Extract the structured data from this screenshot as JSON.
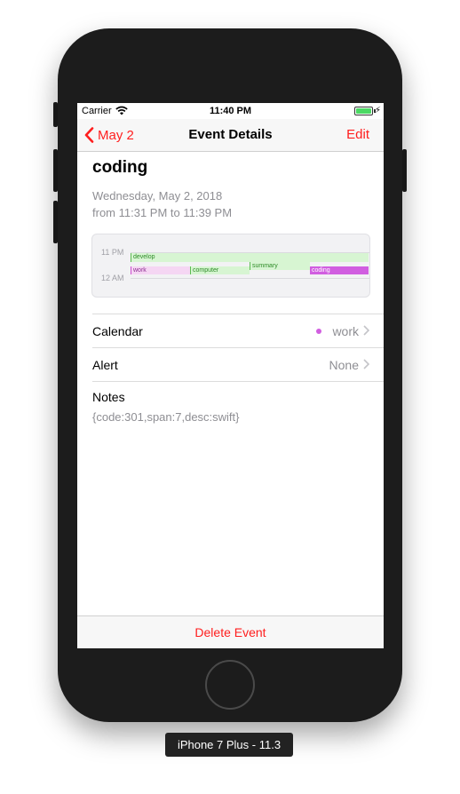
{
  "status_bar": {
    "carrier": "Carrier",
    "time": "11:40 PM",
    "battery_color": "#4cd964",
    "icons": [
      "wifi-icon",
      "battery-icon",
      "charging-bolt-icon"
    ]
  },
  "nav": {
    "back_label": "May 2",
    "title": "Event Details",
    "edit_label": "Edit",
    "accent_color": "#ff1e1e"
  },
  "event": {
    "title": "coding",
    "date": "Wednesday, May 2, 2018",
    "time_range": "from 11:31 PM to 11:39 PM"
  },
  "timeline": {
    "hours": [
      "11 PM",
      "12 AM"
    ],
    "events": [
      {
        "label": "develop",
        "color": "#d7f5d2"
      },
      {
        "label": "summary",
        "color": "#d7f5d2"
      },
      {
        "label": "work",
        "color": "#f5d6f3"
      },
      {
        "label": "computer",
        "color": "#d7f5d2"
      },
      {
        "label": "coding",
        "color": "#d15ee0"
      }
    ]
  },
  "calendar_row": {
    "label": "Calendar",
    "value": "work",
    "dot_color": "#d15ee0"
  },
  "alert_row": {
    "label": "Alert",
    "value": "None"
  },
  "notes": {
    "label": "Notes",
    "value": "{code:301,span:7,desc:swift}"
  },
  "delete_label": "Delete Event",
  "device_label": "iPhone 7 Plus - 11.3"
}
